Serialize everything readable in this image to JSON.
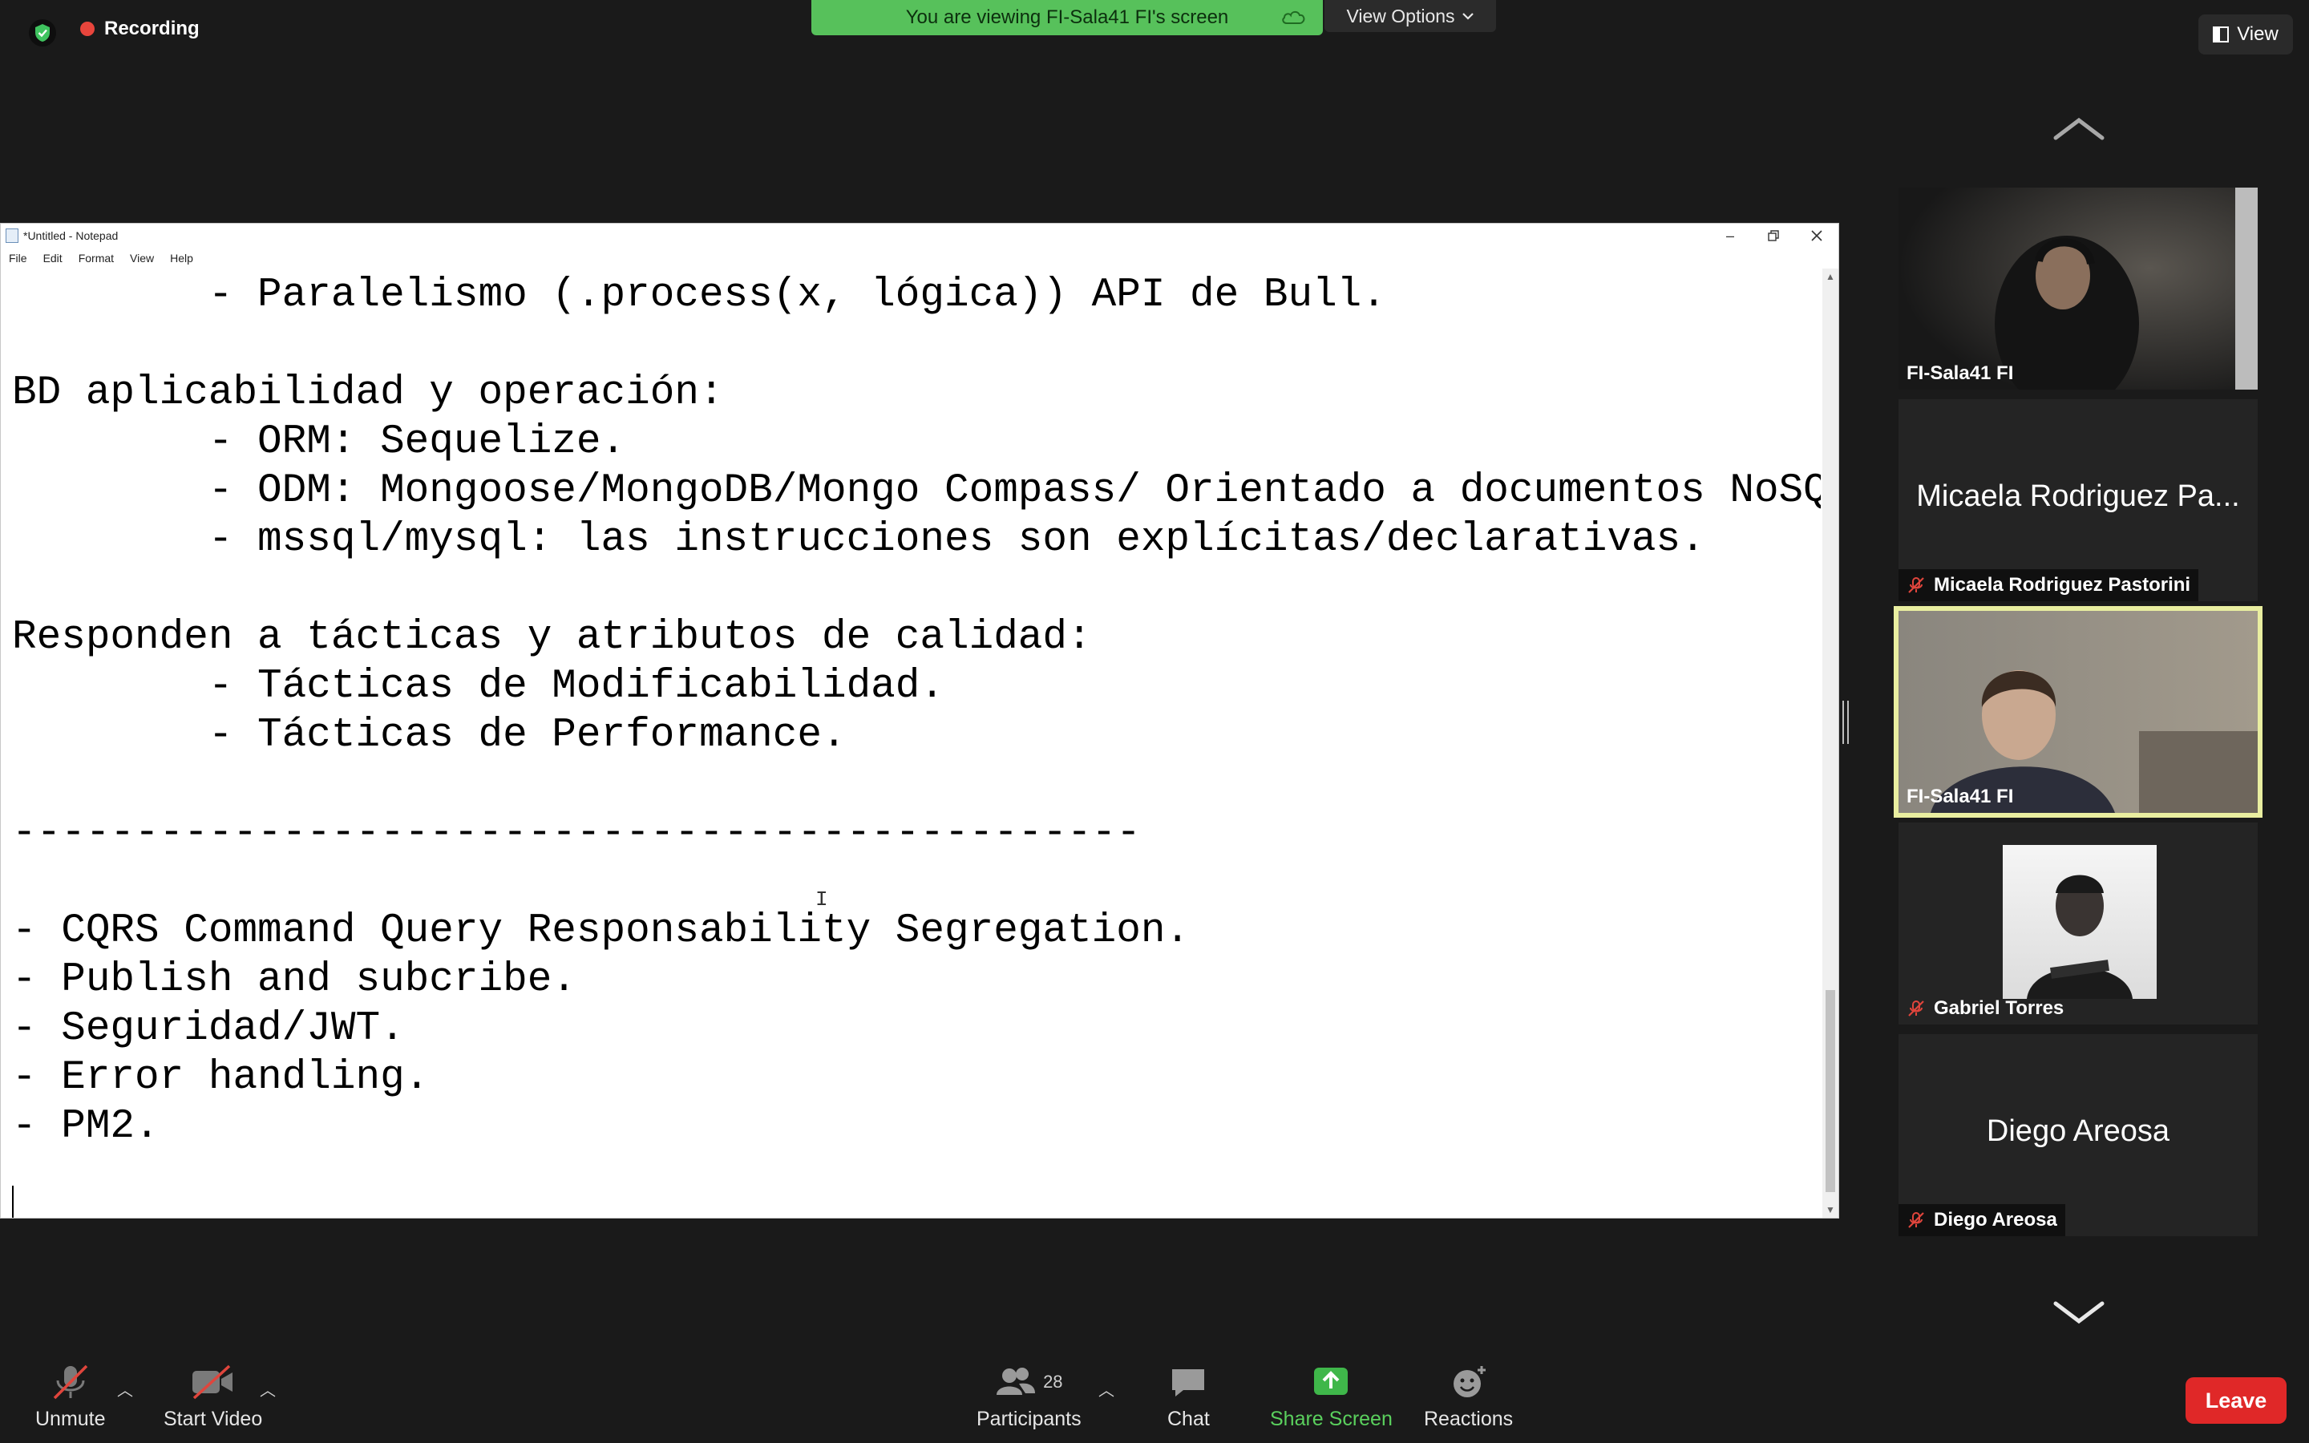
{
  "topbar": {
    "recording_label": "Recording",
    "viewing_banner": "You are viewing FI-Sala41 FI's screen",
    "view_options_label": "View Options",
    "view_label": "View"
  },
  "notepad": {
    "title": "*Untitled - Notepad",
    "menu": [
      "File",
      "Edit",
      "Format",
      "View",
      "Help"
    ],
    "content": "        - Paralelismo (.process(x, lógica)) API de Bull.\n\nBD aplicabilidad y operación:\n        - ORM: Sequelize.\n        - ODM: Mongoose/MongoDB/Mongo Compass/ Orientado a documentos NoSQL.\n        - mssql/mysql: las instrucciones son explícitas/declarativas.\n\nResponden a tácticas y atributos de calidad:\n        - Tácticas de Modificabilidad.\n        - Tácticas de Performance.\n\n----------------------------------------------\n\n- CQRS Command Query Responsability Segregation.\n- Publish and subcribe.\n- Seguridad/JWT.\n- Error handling.\n- PM2."
  },
  "participants": [
    {
      "label": "FI-Sala41 FI",
      "type": "video",
      "muted": false,
      "active": false
    },
    {
      "big_name": "Micaela Rodriguez Pa...",
      "label": "Micaela Rodriguez Pastorini",
      "type": "name",
      "muted": true,
      "active": false
    },
    {
      "label": "FI-Sala41 FI",
      "type": "video",
      "muted": false,
      "active": true
    },
    {
      "label": "Gabriel Torres",
      "type": "photo",
      "muted": true,
      "active": false
    },
    {
      "big_name": "Diego Areosa",
      "label": "Diego Areosa",
      "type": "name",
      "muted": true,
      "active": false
    }
  ],
  "toolbar": {
    "unmute": "Unmute",
    "start_video": "Start Video",
    "participants": "Participants",
    "participants_count": "28",
    "chat": "Chat",
    "share_screen": "Share Screen",
    "reactions": "Reactions",
    "leave": "Leave"
  },
  "colors": {
    "banner_green": "#57c15b",
    "active_speaker_border": "#e9eea0",
    "leave_red": "#e02828",
    "share_green": "#5ad05d",
    "recording_red": "#e8453c"
  }
}
